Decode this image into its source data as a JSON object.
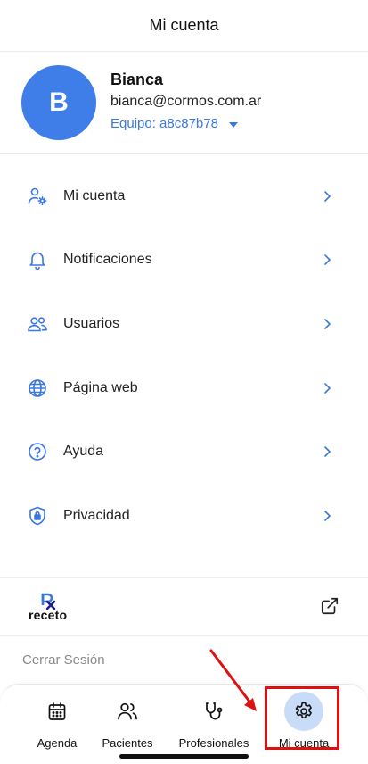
{
  "header": {
    "title": "Mi cuenta"
  },
  "profile": {
    "avatar_letter": "B",
    "name": "Bianca",
    "email": "bianca@cormos.com.ar",
    "team_label": "Equipo: a8c87b78"
  },
  "menu": {
    "items": [
      {
        "label": "Mi cuenta",
        "icon": "user-settings-icon"
      },
      {
        "label": "Notificaciones",
        "icon": "bell-icon"
      },
      {
        "label": "Usuarios",
        "icon": "users-icon"
      },
      {
        "label": "Página web",
        "icon": "globe-icon"
      },
      {
        "label": "Ayuda",
        "icon": "help-circle-icon"
      },
      {
        "label": "Privacidad",
        "icon": "shield-lock-icon"
      }
    ]
  },
  "brand": {
    "name": "receto",
    "icon": "external-link-icon"
  },
  "logout": {
    "label": "Cerrar Sesión"
  },
  "tabbar": {
    "tabs": [
      {
        "label": "Agenda",
        "icon": "calendar-icon"
      },
      {
        "label": "Pacientes",
        "icon": "patients-icon"
      },
      {
        "label": "Profesionales",
        "icon": "stethoscope-icon"
      },
      {
        "label": "Mi cuenta",
        "icon": "gear-icon",
        "active": true
      }
    ]
  },
  "colors": {
    "accent": "#3a78e0",
    "avatar": "#3f7ee8",
    "active_tab_bg": "#c9dcf7",
    "annotation": "#e01010"
  }
}
